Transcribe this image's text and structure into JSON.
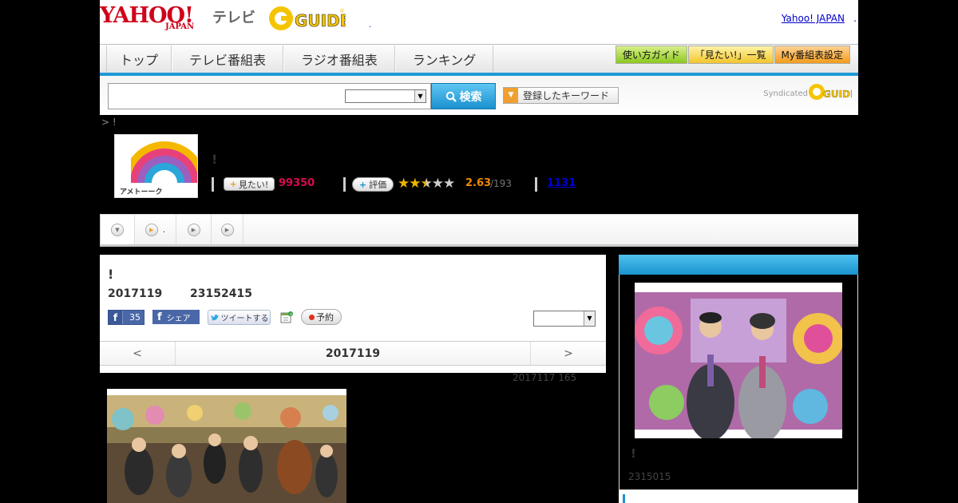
{
  "header": {
    "logo_text": "YAHOO!",
    "logo_sub": "JAPAN",
    "tv_label": "テレビ",
    "gguide_logo": "G-GUIDE",
    "yahoo_japan_link": "Yahoo! JAPAN",
    "link_dot": ".",
    "dot": "."
  },
  "nav": {
    "tabs": [
      {
        "label": "トップ"
      },
      {
        "label": "テレビ番組表"
      },
      {
        "label": "ラジオ番組表"
      },
      {
        "label": "ランキング"
      }
    ],
    "buttons": [
      {
        "label": "使い方ガイド",
        "color": "#8cc81e"
      },
      {
        "label": "「見たい!」一覧",
        "color": "#f2c62b"
      },
      {
        "label": "My番組表設定",
        "color": "#f39c1c"
      }
    ],
    "accent_color": "#1e9ad6"
  },
  "search": {
    "input_value": "",
    "select_value": "",
    "button_label": "検索",
    "keyword_button": "登録したキーワード",
    "syndicated_label": "Syndicated"
  },
  "breadcrumb": "> !",
  "program": {
    "logo_caption": "アメトーーク",
    "title": "!",
    "mitai_label": "見たい!",
    "mitai_count": "99350",
    "hyoka_label": "評価",
    "stars_filled": 2.5,
    "rating": "2.63",
    "rating_count": "/193",
    "link_count": "1131"
  },
  "subtabs": [
    {
      "label": "",
      "icon": "chevron-down-icon",
      "active": true
    },
    {
      "label": ".",
      "icon": "play-icon",
      "active": false
    },
    {
      "label": "",
      "icon": "play-icon",
      "active": false
    },
    {
      "label": "",
      "icon": "play-icon",
      "active": false
    }
  ],
  "main": {
    "title": "!",
    "date": "2017119",
    "time": "23152415",
    "fb_like_count": "35",
    "fb_share_label": "シェア",
    "tweet_label": "ツイートする",
    "reserve_label": "予約",
    "select_value": "",
    "prev_label": "<",
    "current_day": "2017119",
    "next_label": ">"
  },
  "update_note": "2017117  165",
  "sidebar": {
    "title": "!",
    "date": "2315015"
  }
}
